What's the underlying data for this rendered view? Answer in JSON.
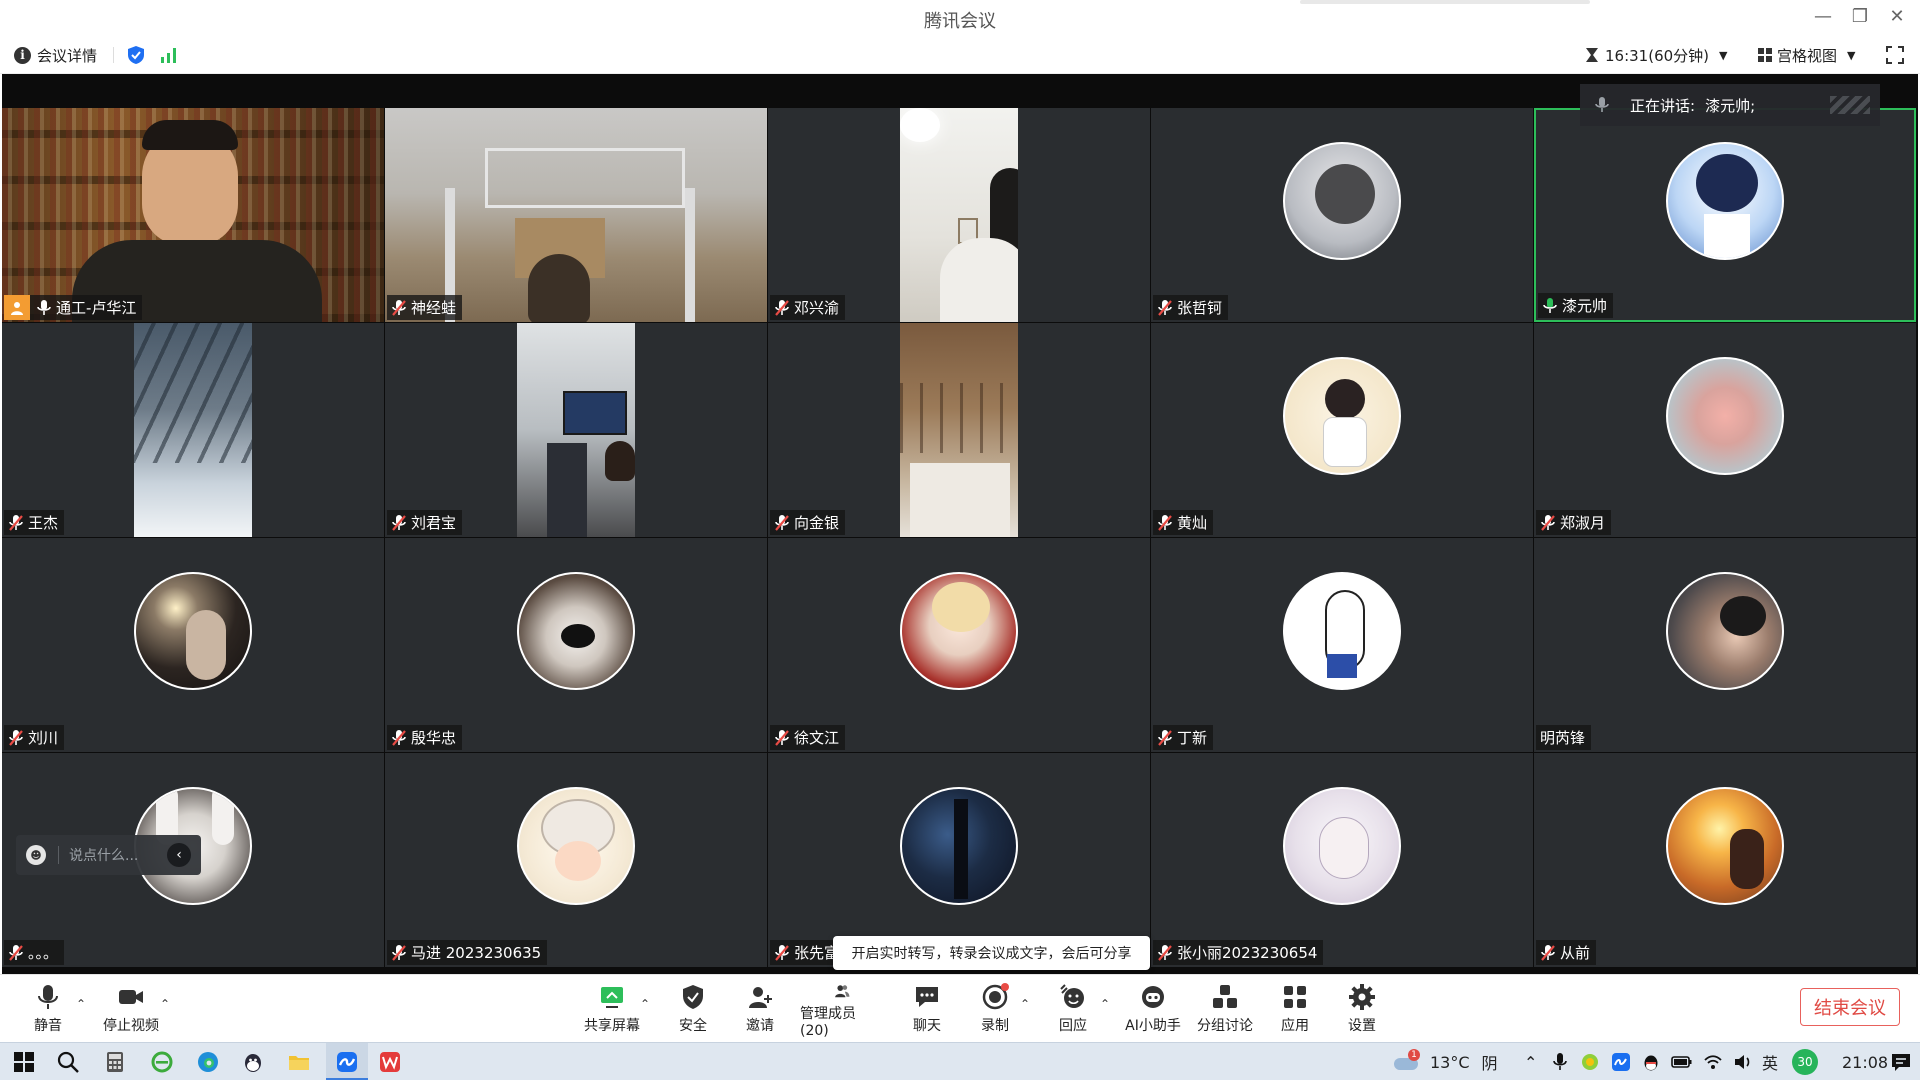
{
  "window": {
    "title": "腾讯会议"
  },
  "infobar": {
    "meeting_details": "会议详情",
    "timer": "16:31(60分钟)",
    "view_mode": "宫格视图"
  },
  "speaking": {
    "label": "正在讲话:",
    "name": "漆元帅;"
  },
  "participants": [
    {
      "name": "通工-卢华江"
    },
    {
      "name": "神经蛙"
    },
    {
      "name": "邓兴渝"
    },
    {
      "name": "张哲钶"
    },
    {
      "name": "漆元帅"
    },
    {
      "name": "王杰"
    },
    {
      "name": "刘君宝"
    },
    {
      "name": "向金银"
    },
    {
      "name": "黄灿"
    },
    {
      "name": "郑淑月"
    },
    {
      "name": "刘川"
    },
    {
      "name": "殷华忠"
    },
    {
      "name": "徐文江"
    },
    {
      "name": "丁新"
    },
    {
      "name": "明芮锋"
    },
    {
      "name": "。。。"
    },
    {
      "name": "马进  2023230635"
    },
    {
      "name": "张先富"
    },
    {
      "name": "张小丽2023230654"
    },
    {
      "name": "从前"
    }
  ],
  "chat": {
    "placeholder": "说点什么..."
  },
  "tooltip": {
    "text": "开启实时转写，转录会议成文字，会后可分享"
  },
  "toolbar": {
    "mute": "静音",
    "stop_video": "停止视频",
    "share_screen": "共享屏幕",
    "security": "安全",
    "invite": "邀请",
    "manage_members": "管理成员(20)",
    "chat": "聊天",
    "record": "录制",
    "reactions": "回应",
    "ai_assistant": "AI小助手",
    "breakout": "分组讨论",
    "apps": "应用",
    "settings": "设置",
    "end_meeting": "结束会议"
  },
  "taskbar": {
    "weather_temp": "13°C",
    "weather_desc": "阴",
    "ime": "英",
    "battery_badge": "30",
    "clock": "21:08"
  },
  "colors": {
    "accent_green": "#2dbe5a",
    "end_red": "#e04a44",
    "tile_bg": "#2a2d30",
    "host_badge": "#f39c32"
  }
}
